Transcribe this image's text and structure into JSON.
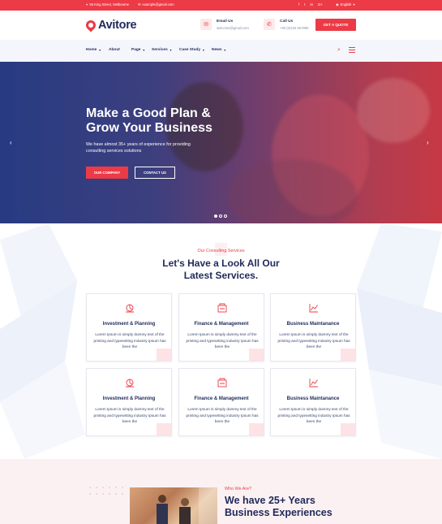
{
  "topbar": {
    "address": "55 King Street, Melbourne",
    "email": "example@gmail.com",
    "social": [
      "f",
      "t",
      "in",
      "G+"
    ],
    "language": "English"
  },
  "header": {
    "logo_text": "Avitore",
    "email_title": "Email Us",
    "email_value": "welcome@gmail.com",
    "call_title": "Call Us",
    "call_value": "+90 (0)234 567890",
    "quote_button": "GET A QUOTE"
  },
  "nav": {
    "items": [
      {
        "label": "Home"
      },
      {
        "label": "About"
      },
      {
        "label": "Page"
      },
      {
        "label": "Services"
      },
      {
        "label": "Case Study"
      },
      {
        "label": "News"
      }
    ]
  },
  "hero": {
    "title_line1": "Make a Good Plan &",
    "title_line2": "Grow Your Business",
    "subtitle": "We have almost 35+ years of experience for providing consulting services solutions",
    "btn_primary": "OUR COMPANY",
    "btn_secondary": "CONTACT US",
    "slide_count": 3,
    "active_slide": 1
  },
  "services": {
    "eyebrow": "Our Consulting Services",
    "title_line1": "Let's Have a Look All Our",
    "title_line2": "Latest Services.",
    "cards": [
      {
        "title": "Investment & Planning",
        "text": "Lorem Ipsum is simply dummy text of the printing and typesetting industry Ipsum has been the",
        "icon": "planning-icon"
      },
      {
        "title": "Finance & Management",
        "text": "Lorem Ipsum is simply dummy text of the printing and typesetting industry Ipsum has been the",
        "icon": "finance-icon"
      },
      {
        "title": "Business Maintanance",
        "text": "Lorem Ipsum is simply dummy text of the printing and typesetting industry Ipsum has been the",
        "icon": "chart-icon"
      },
      {
        "title": "Investment & Planning",
        "text": "Lorem Ipsum is simply dummy text of the printing and typesetting industry Ipsum has been the",
        "icon": "planning-icon"
      },
      {
        "title": "Finance & Management",
        "text": "Lorem Ipsum is simply dummy text of the printing and typesetting industry Ipsum has been the",
        "icon": "finance-icon"
      },
      {
        "title": "Business Maintanance",
        "text": "Lorem Ipsum is simply dummy text of the printing and typesetting industry Ipsum has been the",
        "icon": "chart-icon"
      }
    ]
  },
  "about": {
    "eyebrow": "Who We Are?",
    "title_line1": "We have 25+ Years",
    "title_line2": "Business Experiences"
  },
  "colors": {
    "accent": "#ec3a46",
    "navy": "#1f2a5a",
    "nav_bg": "#f5f6fb"
  }
}
